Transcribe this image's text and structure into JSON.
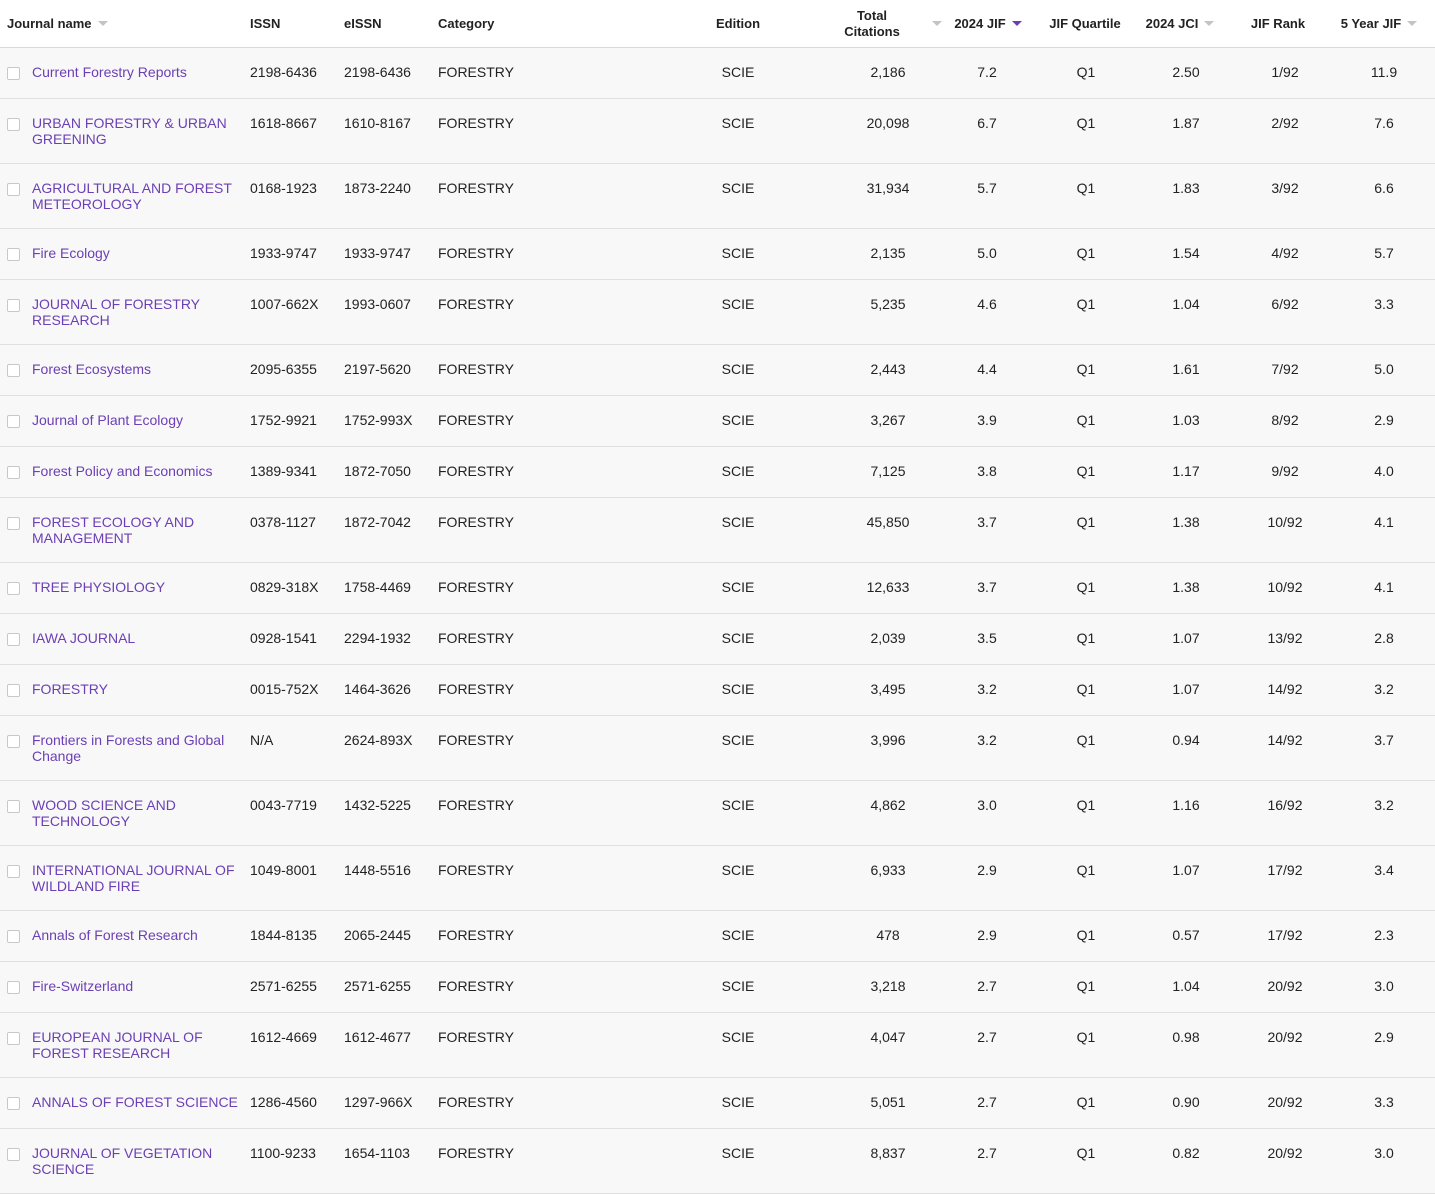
{
  "headers": {
    "journal_name": "Journal name",
    "issn": "ISSN",
    "eissn": "eISSN",
    "category": "Category",
    "edition": "Edition",
    "total_citations": "Total\nCitations",
    "jif": "2024 JIF",
    "jif_quartile": "JIF Quartile",
    "jci": "2024 JCI",
    "jif_rank": "JIF Rank",
    "five_year_jif": "5 Year JIF"
  },
  "accent_color": "#6b3fb5",
  "rows": [
    {
      "name": "Current Forestry Reports",
      "issn": "2198-6436",
      "eissn": "2198-6436",
      "category": "FORESTRY",
      "edition": "SCIE",
      "citations": "2,186",
      "jif": "7.2",
      "quartile": "Q1",
      "jci": "2.50",
      "rank": "1/92",
      "five": "11.9"
    },
    {
      "name": "URBAN FORESTRY & URBAN GREENING",
      "issn": "1618-8667",
      "eissn": "1610-8167",
      "category": "FORESTRY",
      "edition": "SCIE",
      "citations": "20,098",
      "jif": "6.7",
      "quartile": "Q1",
      "jci": "1.87",
      "rank": "2/92",
      "five": "7.6"
    },
    {
      "name": "AGRICULTURAL AND FOREST METEOROLOGY",
      "issn": "0168-1923",
      "eissn": "1873-2240",
      "category": "FORESTRY",
      "edition": "SCIE",
      "citations": "31,934",
      "jif": "5.7",
      "quartile": "Q1",
      "jci": "1.83",
      "rank": "3/92",
      "five": "6.6"
    },
    {
      "name": "Fire Ecology",
      "issn": "1933-9747",
      "eissn": "1933-9747",
      "category": "FORESTRY",
      "edition": "SCIE",
      "citations": "2,135",
      "jif": "5.0",
      "quartile": "Q1",
      "jci": "1.54",
      "rank": "4/92",
      "five": "5.7"
    },
    {
      "name": "JOURNAL OF FORESTRY RESEARCH",
      "issn": "1007-662X",
      "eissn": "1993-0607",
      "category": "FORESTRY",
      "edition": "SCIE",
      "citations": "5,235",
      "jif": "4.6",
      "quartile": "Q1",
      "jci": "1.04",
      "rank": "6/92",
      "five": "3.3"
    },
    {
      "name": "Forest Ecosystems",
      "issn": "2095-6355",
      "eissn": "2197-5620",
      "category": "FORESTRY",
      "edition": "SCIE",
      "citations": "2,443",
      "jif": "4.4",
      "quartile": "Q1",
      "jci": "1.61",
      "rank": "7/92",
      "five": "5.0"
    },
    {
      "name": "Journal of Plant Ecology",
      "issn": "1752-9921",
      "eissn": "1752-993X",
      "category": "FORESTRY",
      "edition": "SCIE",
      "citations": "3,267",
      "jif": "3.9",
      "quartile": "Q1",
      "jci": "1.03",
      "rank": "8/92",
      "five": "2.9"
    },
    {
      "name": "Forest Policy and Economics",
      "issn": "1389-9341",
      "eissn": "1872-7050",
      "category": "FORESTRY",
      "edition": "SCIE",
      "citations": "7,125",
      "jif": "3.8",
      "quartile": "Q1",
      "jci": "1.17",
      "rank": "9/92",
      "five": "4.0"
    },
    {
      "name": "FOREST ECOLOGY AND MANAGEMENT",
      "issn": "0378-1127",
      "eissn": "1872-7042",
      "category": "FORESTRY",
      "edition": "SCIE",
      "citations": "45,850",
      "jif": "3.7",
      "quartile": "Q1",
      "jci": "1.38",
      "rank": "10/92",
      "five": "4.1"
    },
    {
      "name": "TREE PHYSIOLOGY",
      "issn": "0829-318X",
      "eissn": "1758-4469",
      "category": "FORESTRY",
      "edition": "SCIE",
      "citations": "12,633",
      "jif": "3.7",
      "quartile": "Q1",
      "jci": "1.38",
      "rank": "10/92",
      "five": "4.1"
    },
    {
      "name": "IAWA JOURNAL",
      "issn": "0928-1541",
      "eissn": "2294-1932",
      "category": "FORESTRY",
      "edition": "SCIE",
      "citations": "2,039",
      "jif": "3.5",
      "quartile": "Q1",
      "jci": "1.07",
      "rank": "13/92",
      "five": "2.8"
    },
    {
      "name": "FORESTRY",
      "issn": "0015-752X",
      "eissn": "1464-3626",
      "category": "FORESTRY",
      "edition": "SCIE",
      "citations": "3,495",
      "jif": "3.2",
      "quartile": "Q1",
      "jci": "1.07",
      "rank": "14/92",
      "five": "3.2"
    },
    {
      "name": "Frontiers in Forests and Global Change",
      "issn": "N/A",
      "eissn": "2624-893X",
      "category": "FORESTRY",
      "edition": "SCIE",
      "citations": "3,996",
      "jif": "3.2",
      "quartile": "Q1",
      "jci": "0.94",
      "rank": "14/92",
      "five": "3.7"
    },
    {
      "name": "WOOD SCIENCE AND TECHNOLOGY",
      "issn": "0043-7719",
      "eissn": "1432-5225",
      "category": "FORESTRY",
      "edition": "SCIE",
      "citations": "4,862",
      "jif": "3.0",
      "quartile": "Q1",
      "jci": "1.16",
      "rank": "16/92",
      "five": "3.2"
    },
    {
      "name": "INTERNATIONAL JOURNAL OF WILDLAND FIRE",
      "issn": "1049-8001",
      "eissn": "1448-5516",
      "category": "FORESTRY",
      "edition": "SCIE",
      "citations": "6,933",
      "jif": "2.9",
      "quartile": "Q1",
      "jci": "1.07",
      "rank": "17/92",
      "five": "3.4"
    },
    {
      "name": "Annals of Forest Research",
      "issn": "1844-8135",
      "eissn": "2065-2445",
      "category": "FORESTRY",
      "edition": "SCIE",
      "citations": "478",
      "jif": "2.9",
      "quartile": "Q1",
      "jci": "0.57",
      "rank": "17/92",
      "five": "2.3"
    },
    {
      "name": "Fire-Switzerland",
      "issn": "2571-6255",
      "eissn": "2571-6255",
      "category": "FORESTRY",
      "edition": "SCIE",
      "citations": "3,218",
      "jif": "2.7",
      "quartile": "Q1",
      "jci": "1.04",
      "rank": "20/92",
      "five": "3.0"
    },
    {
      "name": "EUROPEAN JOURNAL OF FOREST RESEARCH",
      "issn": "1612-4669",
      "eissn": "1612-4677",
      "category": "FORESTRY",
      "edition": "SCIE",
      "citations": "4,047",
      "jif": "2.7",
      "quartile": "Q1",
      "jci": "0.98",
      "rank": "20/92",
      "five": "2.9"
    },
    {
      "name": "ANNALS OF FOREST SCIENCE",
      "issn": "1286-4560",
      "eissn": "1297-966X",
      "category": "FORESTRY",
      "edition": "SCIE",
      "citations": "5,051",
      "jif": "2.7",
      "quartile": "Q1",
      "jci": "0.90",
      "rank": "20/92",
      "five": "3.3"
    },
    {
      "name": "JOURNAL OF VEGETATION SCIENCE",
      "issn": "1100-9233",
      "eissn": "1654-1103",
      "category": "FORESTRY",
      "edition": "SCIE",
      "citations": "8,837",
      "jif": "2.7",
      "quartile": "Q1",
      "jci": "0.82",
      "rank": "20/92",
      "five": "3.0"
    }
  ]
}
